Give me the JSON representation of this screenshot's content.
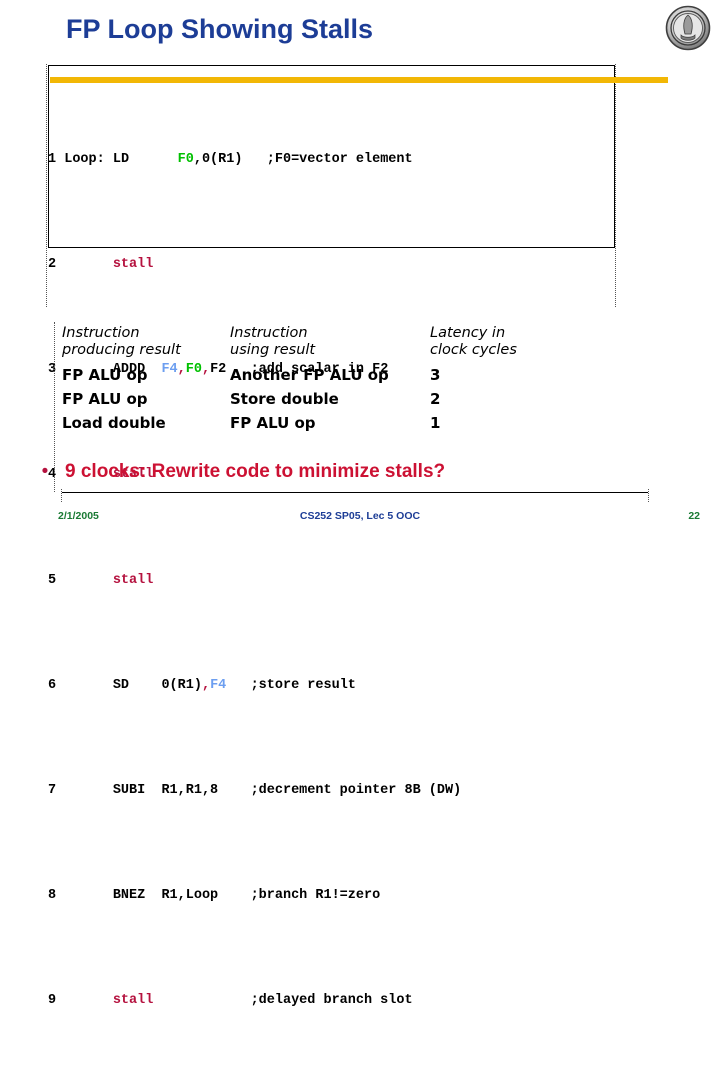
{
  "slide": {
    "title": "FP Loop Showing Stalls",
    "logo_alt": "uc-berkeley-seal",
    "accent_yellow": "#f2b705",
    "title_color": "#1d3d96",
    "stall_color": "#b5123f",
    "reg_green": "#00c000",
    "reg_blue": "#6c9ef0",
    "bullet_color": "#cc1133"
  },
  "code": {
    "lines": [
      {
        "num": "1",
        "text": "1 Loop: LD    F0,0(R1)   ;F0=vector element"
      },
      {
        "num": "2",
        "text": "2       stall"
      },
      {
        "num": "3",
        "text": "3       ADDD  F4,F0,F2   ;add scalar in F2"
      },
      {
        "num": "4",
        "text": "4       stall"
      },
      {
        "num": "5",
        "text": "5       stall"
      },
      {
        "num": "6",
        "text": "6       SD    0(R1),F4   ;store result"
      },
      {
        "num": "7",
        "text": "7       SUBI  R1,R1,8    ;decrement pointer 8B (DW)"
      },
      {
        "num": "8",
        "text": "8       BNEZ  R1,Loop    ;branch R1!=zero"
      },
      {
        "num": "9",
        "text": "9       stall            ;delayed branch slot"
      }
    ],
    "l1": {
      "num": "1",
      "label": "Loop:",
      "op": "LD",
      "r1": "F0",
      "rest": ",0(R1)",
      "comment": ";F0=vector element"
    },
    "l2": {
      "num": "2",
      "stall": "stall"
    },
    "l3": {
      "num": "3",
      "op": "ADDD",
      "r1": "F4",
      "c1": ",",
      "r2": "F0",
      "c2": ",",
      "r3": "F2",
      "comment": ";add scalar in F2"
    },
    "l4": {
      "num": "4",
      "stall": "stall"
    },
    "l5": {
      "num": "5",
      "stall": "stall"
    },
    "l6": {
      "num": "6",
      "op": "SD",
      "a1": "0(R1)",
      "c1": ",",
      "r1": "F4",
      "comment": ";store result"
    },
    "l7": {
      "num": "7",
      "op": "SUBI",
      "args": "R1,R1,8",
      "comment": ";decrement pointer 8B (DW)"
    },
    "l8": {
      "num": "8",
      "op": "BNEZ",
      "args": "R1,Loop",
      "comment": ";branch R1!=zero"
    },
    "l9": {
      "num": "9",
      "stall": "stall",
      "comment": ";delayed branch slot"
    }
  },
  "latency_table": {
    "headers": [
      {
        "line1": "Instruction",
        "line2": "producing result"
      },
      {
        "line1": "Instruction",
        "line2": "using result"
      },
      {
        "line1": "Latency in",
        "line2": "clock cycles"
      }
    ],
    "rows": [
      {
        "producing": "FP ALU op",
        "using": "Another FP ALU op",
        "latency": "3"
      },
      {
        "producing": "FP ALU op",
        "using": "Store double",
        "latency": "2"
      },
      {
        "producing": "Load double",
        "using": "FP ALU op",
        "latency": "1"
      }
    ]
  },
  "bullet": {
    "marker": "•",
    "text": "9 clocks: Rewrite code to minimize stalls?"
  },
  "footer": {
    "date": "2/1/2005",
    "center": "CS252 SP05, Lec 5 OOC",
    "page": "22"
  }
}
